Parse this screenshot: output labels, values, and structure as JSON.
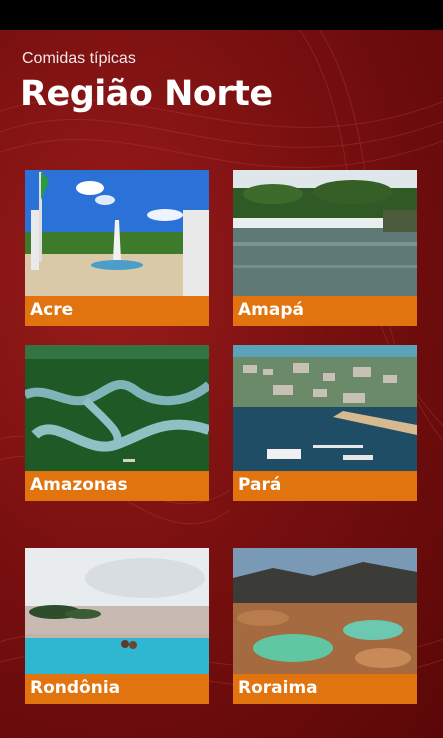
{
  "header": {
    "subtitle": "Comidas típicas",
    "title": "Região Norte"
  },
  "tiles": [
    {
      "label": "Acre",
      "image": "acre-city-square-photo"
    },
    {
      "label": "Amapá",
      "image": "amapa-river-rapids-photo"
    },
    {
      "label": "Amazonas",
      "image": "amazonas-river-aerial-photo"
    },
    {
      "label": "Pará",
      "image": "para-harbor-aerial-photo"
    },
    {
      "label": "Rondônia",
      "image": "rondonia-infinity-pool-photo"
    },
    {
      "label": "Roraima",
      "image": "roraima-rock-formation-photo"
    }
  ],
  "colors": {
    "background": "#7a1010",
    "tile_label_bar": "#e2740f",
    "text": "#ffffff"
  }
}
